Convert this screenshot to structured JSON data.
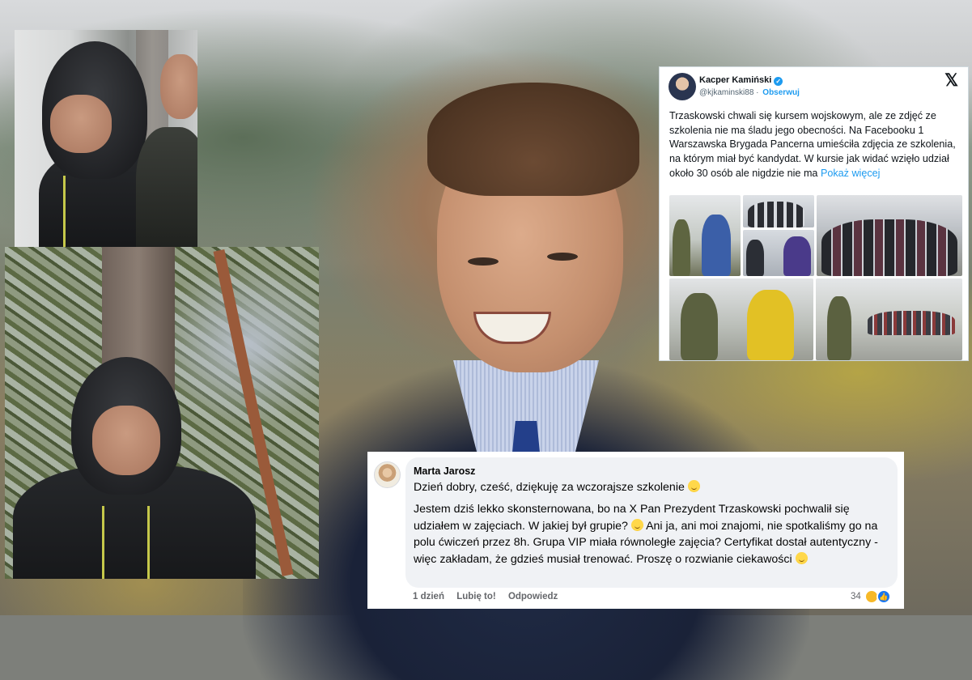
{
  "tweet": {
    "author_name": "Kacper Kamiński",
    "verified_icon": "verified-badge-icon",
    "handle": "@kjkaminski88",
    "separator": " · ",
    "follow_label": "Obserwuj",
    "platform_icon": "x-logo-icon",
    "platform_glyph": "𝕏",
    "text": "Trzaskowski chwali się kursem wojskowym, ale ze zdjęć ze szkolenia nie ma śladu jego obecności. Na Facebooku 1 Warszawska Brygada Pancerna umieściła zdjęcia ze szkolenia, na którym miał być kandydat. W kursie jak widać wzięło udział około 30 osób ale nigdzie nie ma",
    "show_more_label": "Pokaż więcej",
    "accent_color": "#1d9bf0"
  },
  "comment": {
    "author": "Marta Jarosz",
    "first_line": "Dzień dobry, cześć, dziękuję za wczorajsze szkolenie",
    "body_part1": "Jestem dziś lekko skonsternowana, bo na X Pan Prezydent Trzaskowski pochwalił się udziałem w zajęciach. W jakiej był grupie?",
    "body_part2": "Ani ja, ani moi znajomi, nie spotkaliśmy go na polu ćwiczeń przez 8h. Grupa VIP miała równoległe zajęcia? Certyfikat dostał autentyczny - więc zakładam, że gdzieś musiał trenować. Proszę o rozwianie ciekawości",
    "time": "1 dzień",
    "like_label": "Lubię to!",
    "reply_label": "Odpowiedz",
    "reaction_count": "34",
    "like_glyph": "👍"
  }
}
